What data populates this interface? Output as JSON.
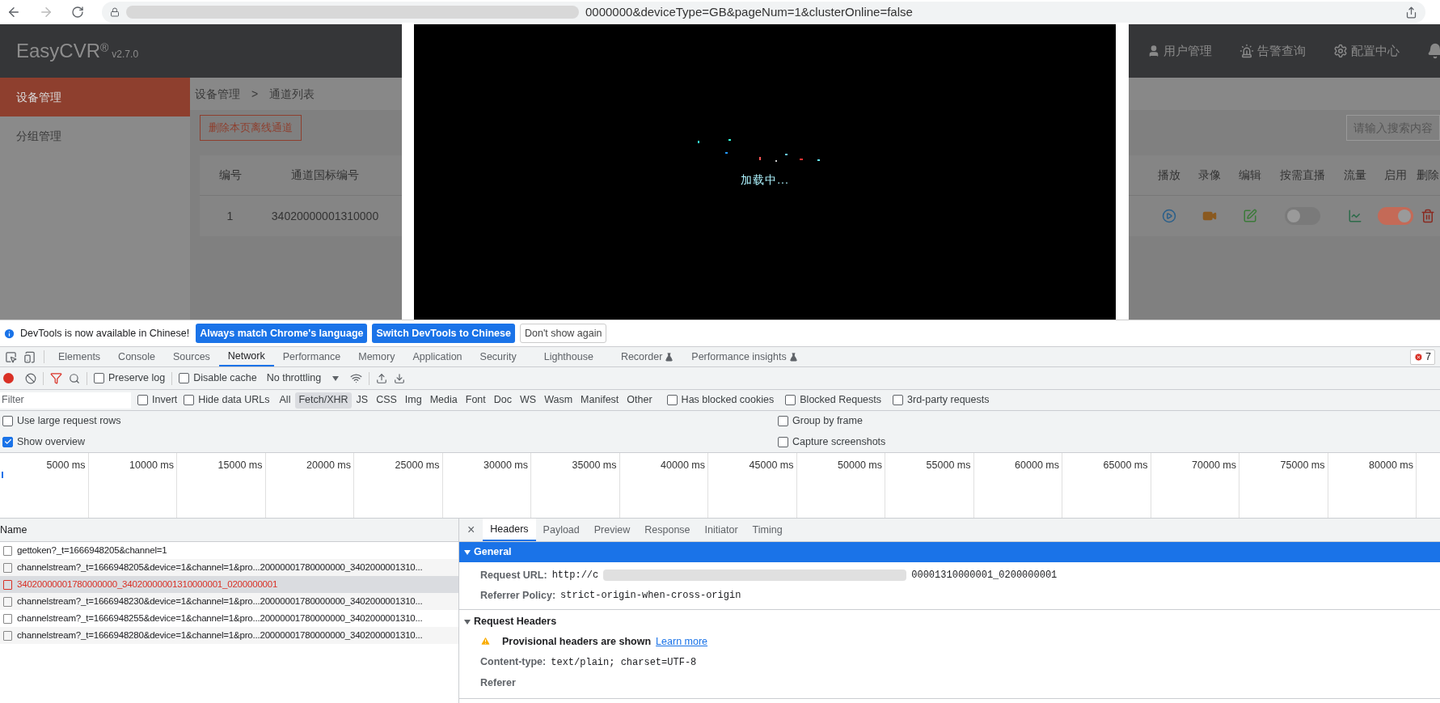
{
  "browser": {
    "url": "0000000&deviceType=GB&pageNum=1&clusterOnline=false"
  },
  "app": {
    "logo": "EasyCVR",
    "logo_mark": "®",
    "version": "v2.7.0",
    "nav": [
      {
        "label": "用户管理",
        "kind": "user"
      },
      {
        "label": "告警查询",
        "kind": "alarm"
      },
      {
        "label": "配置中心",
        "kind": "gear"
      },
      {
        "kind": "bell"
      }
    ],
    "sidebar": [
      {
        "label": "设备管理",
        "selected": true
      },
      {
        "label": "分组管理",
        "selected": false
      }
    ],
    "breadcrumb": [
      "设备管理",
      "通道列表"
    ],
    "breadcrumb_separator": ">",
    "delete_offline_button": "删除本页离线通道",
    "search": {
      "placeholder": "请输入搜索内容"
    },
    "table": {
      "columns_left": [
        "编号",
        "通道国标编号"
      ],
      "columns_right": [
        "播放",
        "录像",
        "编辑",
        "按需直播",
        "流量",
        "启用",
        "删除"
      ],
      "row": {
        "id": "1",
        "channel_code": "34020000001310000",
        "on_demand": false,
        "enabled": true
      }
    }
  },
  "modal": {
    "loading": "加载中..."
  },
  "devtools": {
    "infobar": {
      "message": "DevTools is now available in Chinese!",
      "buttons": [
        "Always match Chrome's language",
        "Switch DevTools to Chinese"
      ],
      "dismiss": "Don't show again"
    },
    "tabs": [
      {
        "label": "Elements",
        "selected": false,
        "experimental": false
      },
      {
        "label": "Console",
        "selected": false,
        "experimental": false
      },
      {
        "label": "Sources",
        "selected": false,
        "experimental": false
      },
      {
        "label": "Network",
        "selected": true,
        "experimental": false
      },
      {
        "label": "Performance",
        "selected": false,
        "experimental": false
      },
      {
        "label": "Memory",
        "selected": false,
        "experimental": false
      },
      {
        "label": "Application",
        "selected": false,
        "experimental": false
      },
      {
        "label": "Security",
        "selected": false,
        "experimental": false
      },
      {
        "label": "Lighthouse",
        "selected": false,
        "experimental": false
      },
      {
        "label": "Recorder",
        "selected": false,
        "experimental": true
      },
      {
        "label": "Performance insights",
        "selected": false,
        "experimental": true
      }
    ],
    "error_count": "7",
    "toolbar": {
      "recording": true,
      "filter_active": true,
      "preserve_log": {
        "label": "Preserve log",
        "checked": false
      },
      "disable_cache": {
        "label": "Disable cache",
        "checked": false
      },
      "throttling": "No throttling"
    },
    "filter": {
      "placeholder": "Filter",
      "invert": {
        "label": "Invert",
        "checked": false
      },
      "hide_data_urls": {
        "label": "Hide data URLs",
        "checked": false
      },
      "types": [
        {
          "label": "All",
          "selected": false
        },
        {
          "label": "Fetch/XHR",
          "selected": true
        },
        {
          "label": "JS",
          "selected": false
        },
        {
          "label": "CSS",
          "selected": false
        },
        {
          "label": "Img",
          "selected": false
        },
        {
          "label": "Media",
          "selected": false
        },
        {
          "label": "Font",
          "selected": false
        },
        {
          "label": "Doc",
          "selected": false
        },
        {
          "label": "WS",
          "selected": false
        },
        {
          "label": "Wasm",
          "selected": false
        },
        {
          "label": "Manifest",
          "selected": false
        },
        {
          "label": "Other",
          "selected": false
        }
      ],
      "extra": [
        {
          "label": "Has blocked cookies",
          "checked": false
        },
        {
          "label": "Blocked Requests",
          "checked": false
        },
        {
          "label": "3rd-party requests",
          "checked": false
        }
      ]
    },
    "options_left": [
      {
        "label": "Use large request rows",
        "checked": false
      },
      {
        "label": "Show overview",
        "checked": true
      }
    ],
    "options_right": [
      {
        "label": "Group by frame",
        "checked": false
      },
      {
        "label": "Capture screenshots",
        "checked": false
      }
    ],
    "overview_ticks": [
      "5000 ms",
      "10000 ms",
      "15000 ms",
      "20000 ms",
      "25000 ms",
      "30000 ms",
      "35000 ms",
      "40000 ms",
      "45000 ms",
      "50000 ms",
      "55000 ms",
      "60000 ms",
      "65000 ms",
      "70000 ms",
      "75000 ms",
      "80000 ms"
    ],
    "requests": {
      "column": "Name",
      "rows": [
        {
          "name": "gettoken?_t=1666948205&channel=1",
          "selected": false,
          "failed": false
        },
        {
          "name": "channelstream?_t=1666948205&device=1&channel=1&pro...20000001780000000_3402000001310...",
          "selected": false,
          "failed": false
        },
        {
          "name": "34020000001780000000_34020000001310000001_0200000001",
          "selected": true,
          "failed": true
        },
        {
          "name": "channelstream?_t=1666948230&device=1&channel=1&pro...20000001780000000_3402000001310...",
          "selected": false,
          "failed": false
        },
        {
          "name": "channelstream?_t=1666948255&device=1&channel=1&pro...20000001780000000_3402000001310...",
          "selected": false,
          "failed": false
        },
        {
          "name": "channelstream?_t=1666948280&device=1&channel=1&pro...20000001780000000_3402000001310...",
          "selected": false,
          "failed": false
        }
      ]
    },
    "detail": {
      "close": "×",
      "tabs": [
        {
          "label": "Headers",
          "selected": true
        },
        {
          "label": "Payload",
          "selected": false
        },
        {
          "label": "Preview",
          "selected": false
        },
        {
          "label": "Response",
          "selected": false
        },
        {
          "label": "Initiator",
          "selected": false
        },
        {
          "label": "Timing",
          "selected": false
        }
      ],
      "general": {
        "title": "General",
        "expanded": true,
        "request_url": {
          "label": "Request URL:",
          "value_start": "http://c",
          "value_end": "00001310000001_0200000001"
        },
        "referrer_policy": {
          "label": "Referrer Policy:",
          "value": "strict-origin-when-cross-origin"
        }
      },
      "request_headers": {
        "title": "Request Headers",
        "expanded": true,
        "warning": "Provisional headers are shown",
        "link": "Learn more",
        "content_type": {
          "label": "Content-type:",
          "value": "text/plain; charset=UTF-8"
        },
        "referer": "Referer"
      }
    }
  }
}
